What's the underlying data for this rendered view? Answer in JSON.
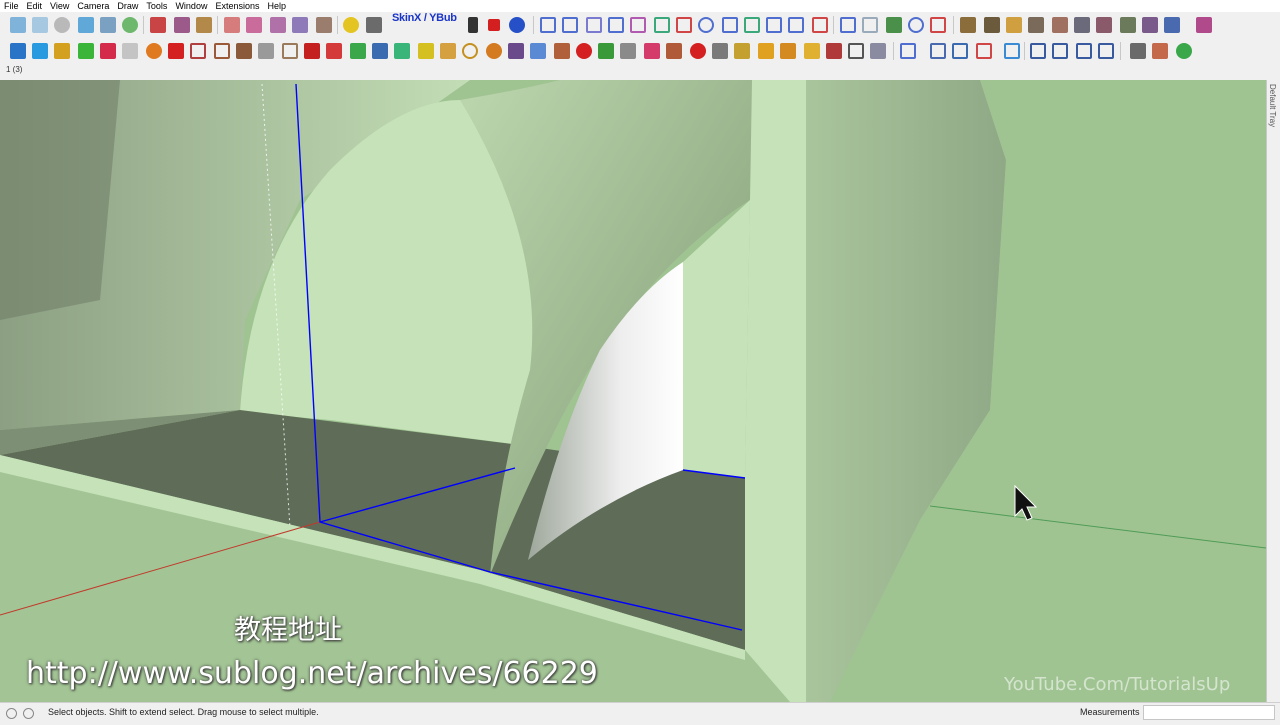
{
  "menu": [
    "File",
    "Edit",
    "View",
    "Camera",
    "Draw",
    "Tools",
    "Window",
    "Extensions",
    "Help"
  ],
  "toolbar": {
    "skin_label": "SkinX / YBub"
  },
  "scene_tab": "1 (3)",
  "tray_label": "Default Tray",
  "status": {
    "message": "Select objects. Shift to extend select. Drag mouse to select multiple.",
    "measurements_label": "Measurements"
  },
  "overlay": {
    "caption_cn": "教程地址",
    "caption_url": "http://www.sublog.net/archives/66229",
    "watermark": "YouTube.Com/TutorialsUp"
  },
  "colors": {
    "face_light": "#c5e0b8",
    "face_mid": "#a9c99d",
    "face_dark": "#5f6d58",
    "selection_blue": "#0000ff",
    "axis_red": "#c0392b",
    "axis_green": "#2e8b3c"
  }
}
